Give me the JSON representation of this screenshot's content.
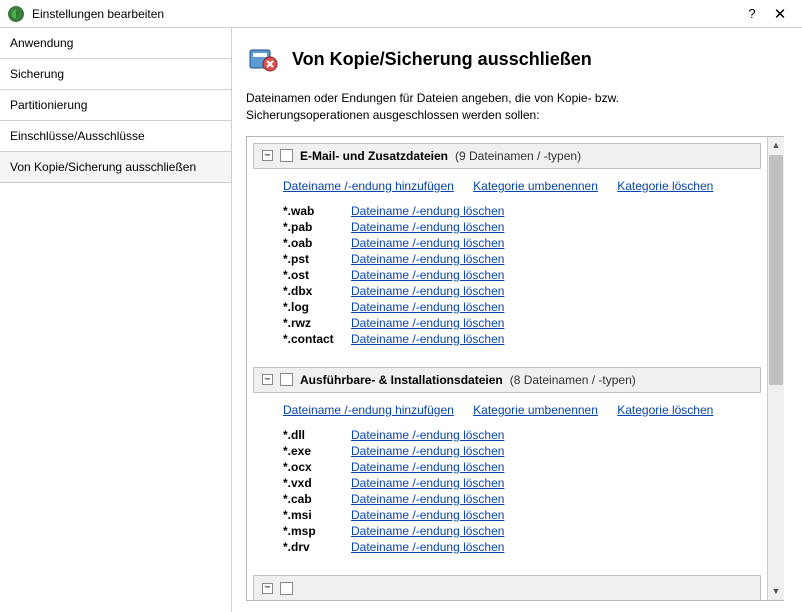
{
  "window": {
    "title": "Einstellungen bearbeiten",
    "help": "?",
    "close": "✕"
  },
  "sidebar": {
    "items": [
      {
        "label": "Anwendung"
      },
      {
        "label": "Sicherung"
      },
      {
        "label": "Partitionierung"
      },
      {
        "label": "Einschlüsse/Ausschlüsse"
      },
      {
        "label": "Von Kopie/Sicherung ausschließen"
      }
    ]
  },
  "page": {
    "title": "Von Kopie/Sicherung ausschließen",
    "description_l1": "Dateinamen oder Endungen für Dateien angeben, die von Kopie- bzw.",
    "description_l2": "Sicherungsoperationen ausgeschlossen werden sollen:"
  },
  "actions": {
    "add": "Dateiname /-endung hinzufügen",
    "rename": "Kategorie umbenennen",
    "delete_cat": "Kategorie löschen",
    "delete_ext": "Dateiname /-endung löschen"
  },
  "categories": [
    {
      "name": "E-Mail- und Zusatzdateien",
      "count": "(9 Dateinamen / -typen)",
      "exts": [
        "*.wab",
        "*.pab",
        "*.oab",
        "*.pst",
        "*.ost",
        "*.dbx",
        "*.log",
        "*.rwz",
        "*.contact"
      ]
    },
    {
      "name": "Ausführbare- & Installationsdateien",
      "count": "(8 Dateinamen / -typen)",
      "exts": [
        "*.dll",
        "*.exe",
        "*.ocx",
        "*.vxd",
        "*.cab",
        "*.msi",
        "*.msp",
        "*.drv"
      ]
    }
  ],
  "expander_glyph": "−"
}
